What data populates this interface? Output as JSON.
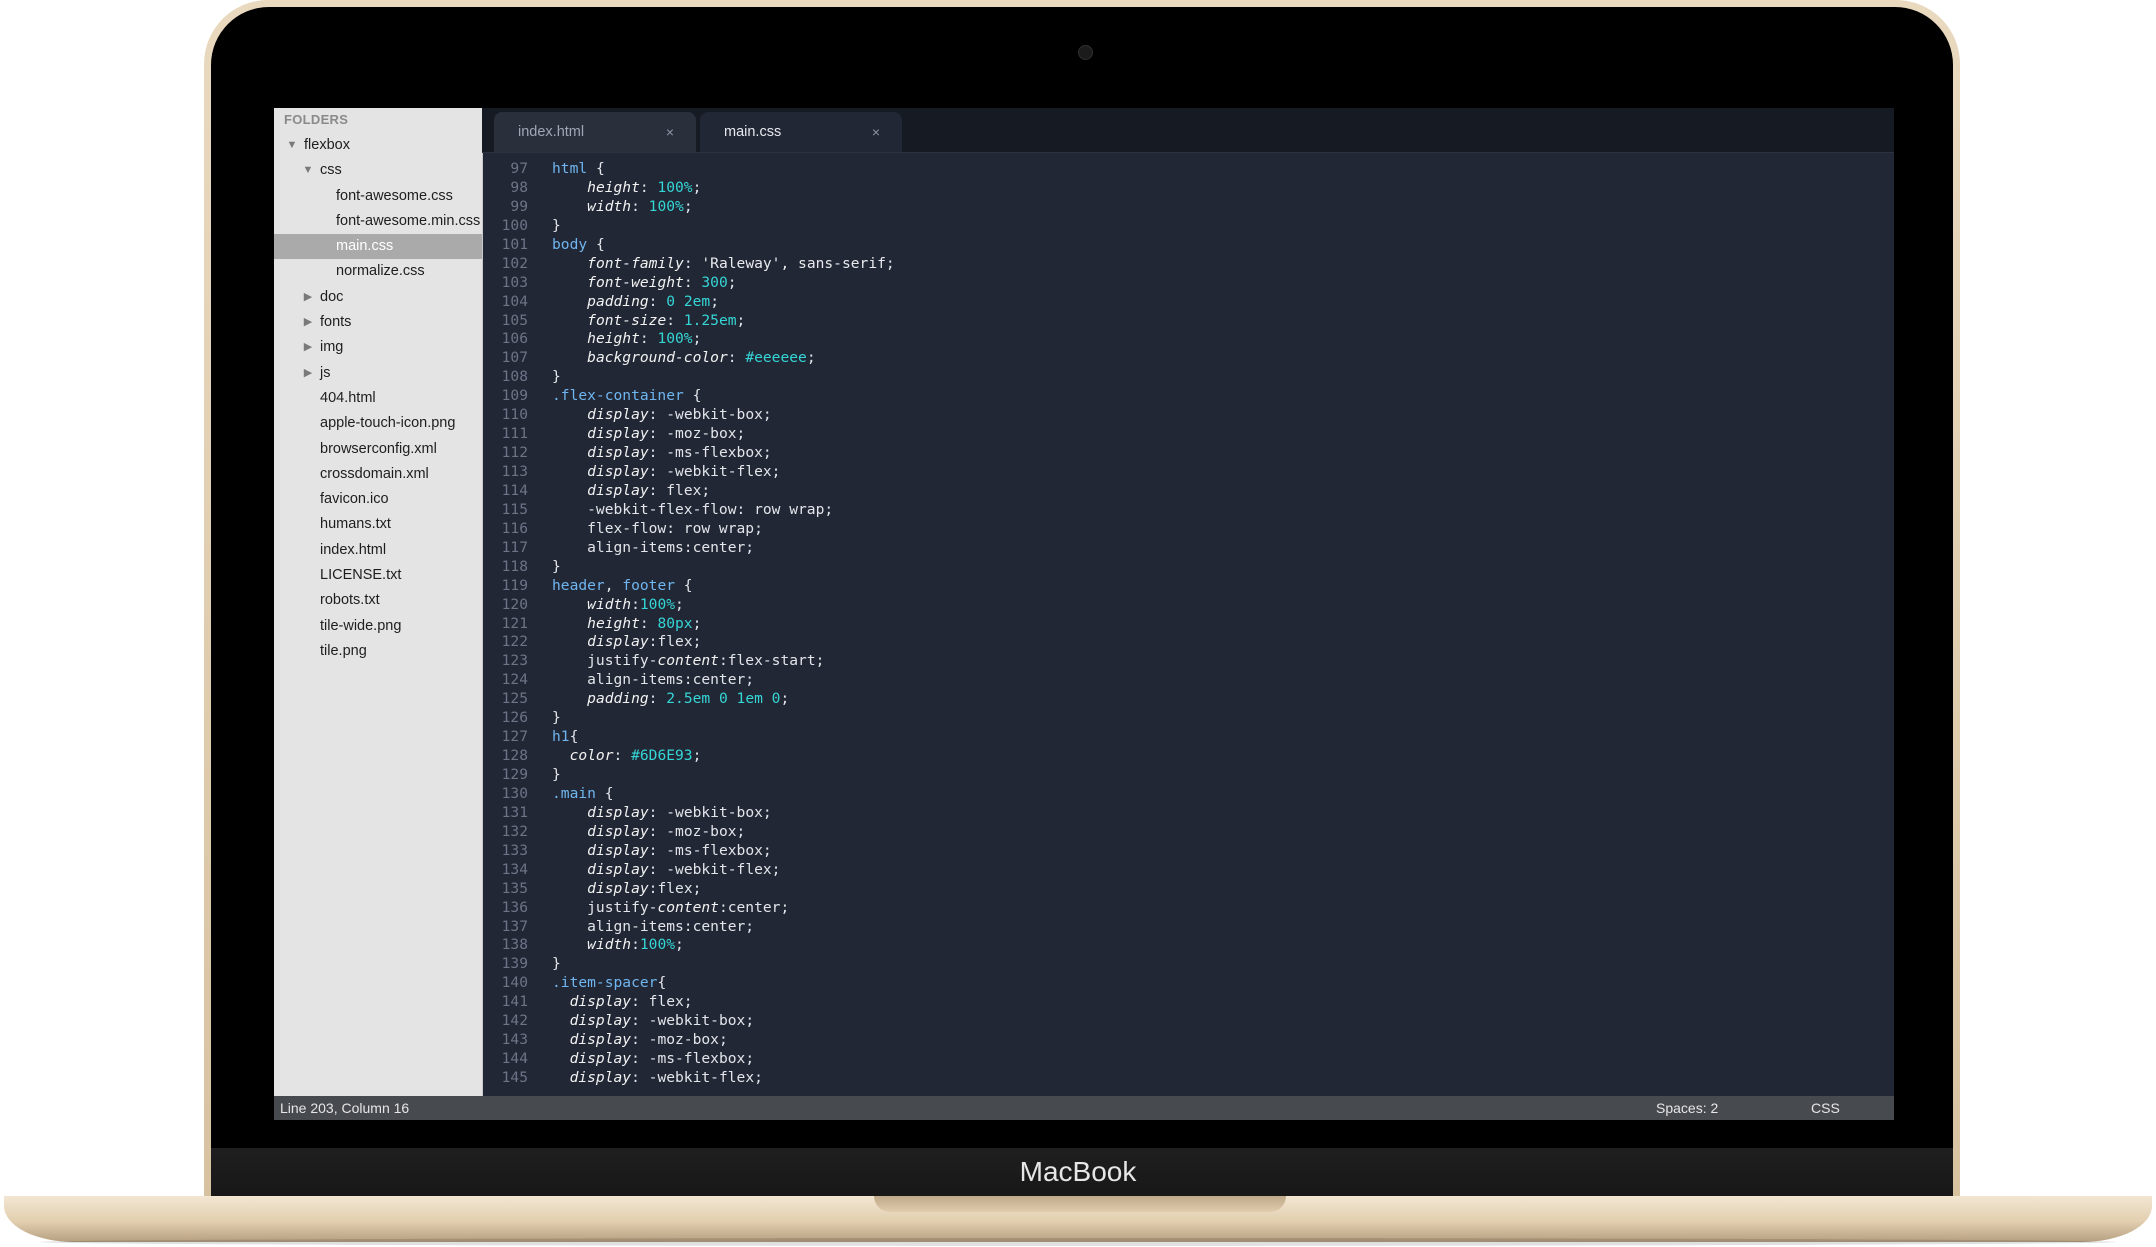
{
  "device": {
    "brand": "MacBook"
  },
  "sidebar": {
    "header": "FOLDERS",
    "tree": [
      {
        "label": "flexbox",
        "depth": 0,
        "arrow": "open"
      },
      {
        "label": "css",
        "depth": 1,
        "arrow": "open"
      },
      {
        "label": "font-awesome.css",
        "depth": 2,
        "arrow": "none"
      },
      {
        "label": "font-awesome.min.css",
        "depth": 2,
        "arrow": "none"
      },
      {
        "label": "main.css",
        "depth": 2,
        "arrow": "none",
        "selected": true
      },
      {
        "label": "normalize.css",
        "depth": 2,
        "arrow": "none"
      },
      {
        "label": "doc",
        "depth": 1,
        "arrow": "closed"
      },
      {
        "label": "fonts",
        "depth": 1,
        "arrow": "closed"
      },
      {
        "label": "img",
        "depth": 1,
        "arrow": "closed"
      },
      {
        "label": "js",
        "depth": 1,
        "arrow": "closed"
      },
      {
        "label": "404.html",
        "depth": 1,
        "arrow": "none"
      },
      {
        "label": "apple-touch-icon.png",
        "depth": 1,
        "arrow": "none"
      },
      {
        "label": "browserconfig.xml",
        "depth": 1,
        "arrow": "none"
      },
      {
        "label": "crossdomain.xml",
        "depth": 1,
        "arrow": "none"
      },
      {
        "label": "favicon.ico",
        "depth": 1,
        "arrow": "none"
      },
      {
        "label": "humans.txt",
        "depth": 1,
        "arrow": "none"
      },
      {
        "label": "index.html",
        "depth": 1,
        "arrow": "none"
      },
      {
        "label": "LICENSE.txt",
        "depth": 1,
        "arrow": "none"
      },
      {
        "label": "robots.txt",
        "depth": 1,
        "arrow": "none"
      },
      {
        "label": "tile-wide.png",
        "depth": 1,
        "arrow": "none"
      },
      {
        "label": "tile.png",
        "depth": 1,
        "arrow": "none"
      }
    ]
  },
  "tabs": [
    {
      "label": "index.html",
      "close": "×",
      "active": false
    },
    {
      "label": "main.css",
      "close": "×",
      "active": true
    }
  ],
  "editor": {
    "lines": [
      {
        "n": "97",
        "t": [
          [
            "html",
            "sel"
          ],
          [
            " {",
            "punc"
          ]
        ]
      },
      {
        "n": "98",
        "t": [
          [
            "    ",
            "punc"
          ],
          [
            "height",
            "prop"
          ],
          [
            ": ",
            "punc"
          ],
          [
            "100%",
            "num"
          ],
          [
            ";",
            "punc"
          ]
        ]
      },
      {
        "n": "99",
        "t": [
          [
            "    ",
            "punc"
          ],
          [
            "width",
            "prop"
          ],
          [
            ": ",
            "punc"
          ],
          [
            "100%",
            "num"
          ],
          [
            ";",
            "punc"
          ]
        ]
      },
      {
        "n": "100",
        "t": [
          [
            "}",
            "punc"
          ]
        ]
      },
      {
        "n": "101",
        "t": [
          [
            "body",
            "sel"
          ],
          [
            " {",
            "punc"
          ]
        ]
      },
      {
        "n": "102",
        "t": [
          [
            "    ",
            "punc"
          ],
          [
            "font-family",
            "prop"
          ],
          [
            ": ",
            "punc"
          ],
          [
            "'Raleway', sans-serif",
            "str"
          ],
          [
            ";",
            "punc"
          ]
        ]
      },
      {
        "n": "103",
        "t": [
          [
            "    ",
            "punc"
          ],
          [
            "font-weight",
            "prop"
          ],
          [
            ": ",
            "punc"
          ],
          [
            "300",
            "num"
          ],
          [
            ";",
            "punc"
          ]
        ]
      },
      {
        "n": "104",
        "t": [
          [
            "    ",
            "punc"
          ],
          [
            "padding",
            "prop"
          ],
          [
            ": ",
            "punc"
          ],
          [
            "0 2em",
            "num"
          ],
          [
            ";",
            "punc"
          ]
        ]
      },
      {
        "n": "105",
        "t": [
          [
            "    ",
            "punc"
          ],
          [
            "font-size",
            "prop"
          ],
          [
            ": ",
            "punc"
          ],
          [
            "1.25em",
            "num"
          ],
          [
            ";",
            "punc"
          ]
        ]
      },
      {
        "n": "106",
        "t": [
          [
            "    ",
            "punc"
          ],
          [
            "height",
            "prop"
          ],
          [
            ": ",
            "punc"
          ],
          [
            "100%",
            "num"
          ],
          [
            ";",
            "punc"
          ]
        ]
      },
      {
        "n": "107",
        "t": [
          [
            "    ",
            "punc"
          ],
          [
            "background-color",
            "prop"
          ],
          [
            ": ",
            "punc"
          ],
          [
            "#eeeeee",
            "num"
          ],
          [
            ";",
            "punc"
          ]
        ]
      },
      {
        "n": "108",
        "t": [
          [
            "}",
            "punc"
          ]
        ]
      },
      {
        "n": "109",
        "t": [
          [
            ".flex-container",
            "sel"
          ],
          [
            " {",
            "punc"
          ]
        ]
      },
      {
        "n": "110",
        "t": [
          [
            "    ",
            "punc"
          ],
          [
            "display",
            "prop"
          ],
          [
            ": -webkit-box;",
            "punc"
          ]
        ]
      },
      {
        "n": "111",
        "t": [
          [
            "    ",
            "punc"
          ],
          [
            "display",
            "prop"
          ],
          [
            ": -moz-box;",
            "punc"
          ]
        ]
      },
      {
        "n": "112",
        "t": [
          [
            "    ",
            "punc"
          ],
          [
            "display",
            "prop"
          ],
          [
            ": -ms-flexbox;",
            "punc"
          ]
        ]
      },
      {
        "n": "113",
        "t": [
          [
            "    ",
            "punc"
          ],
          [
            "display",
            "prop"
          ],
          [
            ": -webkit-flex;",
            "punc"
          ]
        ]
      },
      {
        "n": "114",
        "t": [
          [
            "    ",
            "punc"
          ],
          [
            "display",
            "prop"
          ],
          [
            ": flex;",
            "punc"
          ]
        ]
      },
      {
        "n": "115",
        "t": [
          [
            "    -webkit-flex-flow: row wrap;",
            "punc"
          ]
        ]
      },
      {
        "n": "116",
        "t": [
          [
            "    flex-flow: row wrap;",
            "punc"
          ]
        ]
      },
      {
        "n": "117",
        "t": [
          [
            "    align-items:center;",
            "punc"
          ]
        ]
      },
      {
        "n": "118",
        "t": [
          [
            "}",
            "punc"
          ]
        ]
      },
      {
        "n": "119",
        "t": [
          [
            "header",
            "sel"
          ],
          [
            ", ",
            "punc"
          ],
          [
            "footer",
            "sel"
          ],
          [
            " {",
            "punc"
          ]
        ]
      },
      {
        "n": "120",
        "t": [
          [
            "    ",
            "punc"
          ],
          [
            "width",
            "prop"
          ],
          [
            ":",
            "punc"
          ],
          [
            "100%",
            "num"
          ],
          [
            ";",
            "punc"
          ]
        ]
      },
      {
        "n": "121",
        "t": [
          [
            "    ",
            "punc"
          ],
          [
            "height",
            "prop"
          ],
          [
            ": ",
            "punc"
          ],
          [
            "80px",
            "num"
          ],
          [
            ";",
            "punc"
          ]
        ]
      },
      {
        "n": "122",
        "t": [
          [
            "    ",
            "punc"
          ],
          [
            "display",
            "prop"
          ],
          [
            ":flex;",
            "punc"
          ]
        ]
      },
      {
        "n": "123",
        "t": [
          [
            "    justify-",
            "punc"
          ],
          [
            "content",
            "prop"
          ],
          [
            ":flex-start;",
            "punc"
          ]
        ]
      },
      {
        "n": "124",
        "t": [
          [
            "    align-items:center;",
            "punc"
          ]
        ]
      },
      {
        "n": "125",
        "t": [
          [
            "    ",
            "punc"
          ],
          [
            "padding",
            "prop"
          ],
          [
            ": ",
            "punc"
          ],
          [
            "2.5em 0 1em 0",
            "num"
          ],
          [
            ";",
            "punc"
          ]
        ]
      },
      {
        "n": "126",
        "t": [
          [
            "}",
            "punc"
          ]
        ]
      },
      {
        "n": "127",
        "t": [
          [
            "h1",
            "sel"
          ],
          [
            "{",
            "punc"
          ]
        ]
      },
      {
        "n": "128",
        "t": [
          [
            "  ",
            "punc"
          ],
          [
            "color",
            "prop"
          ],
          [
            ": ",
            "punc"
          ],
          [
            "#6D6E93",
            "num"
          ],
          [
            ";",
            "punc"
          ]
        ]
      },
      {
        "n": "129",
        "t": [
          [
            "}",
            "punc"
          ]
        ]
      },
      {
        "n": "130",
        "t": [
          [
            ".main",
            "sel"
          ],
          [
            " {",
            "punc"
          ]
        ]
      },
      {
        "n": "131",
        "t": [
          [
            "    ",
            "punc"
          ],
          [
            "display",
            "prop"
          ],
          [
            ": -webkit-box;",
            "punc"
          ]
        ]
      },
      {
        "n": "132",
        "t": [
          [
            "    ",
            "punc"
          ],
          [
            "display",
            "prop"
          ],
          [
            ": -moz-box;",
            "punc"
          ]
        ]
      },
      {
        "n": "133",
        "t": [
          [
            "    ",
            "punc"
          ],
          [
            "display",
            "prop"
          ],
          [
            ": -ms-flexbox;",
            "punc"
          ]
        ]
      },
      {
        "n": "134",
        "t": [
          [
            "    ",
            "punc"
          ],
          [
            "display",
            "prop"
          ],
          [
            ": -webkit-flex;",
            "punc"
          ]
        ]
      },
      {
        "n": "135",
        "t": [
          [
            "    ",
            "punc"
          ],
          [
            "display",
            "prop"
          ],
          [
            ":flex;",
            "punc"
          ]
        ]
      },
      {
        "n": "136",
        "t": [
          [
            "    justify-",
            "punc"
          ],
          [
            "content",
            "prop"
          ],
          [
            ":center;",
            "punc"
          ]
        ]
      },
      {
        "n": "137",
        "t": [
          [
            "    align-items:center;",
            "punc"
          ]
        ]
      },
      {
        "n": "138",
        "t": [
          [
            "    ",
            "punc"
          ],
          [
            "width",
            "prop"
          ],
          [
            ":",
            "punc"
          ],
          [
            "100%",
            "num"
          ],
          [
            ";",
            "punc"
          ]
        ]
      },
      {
        "n": "139",
        "t": [
          [
            "}",
            "punc"
          ]
        ]
      },
      {
        "n": "140",
        "t": [
          [
            ".item-spacer",
            "sel"
          ],
          [
            "{",
            "punc"
          ]
        ]
      },
      {
        "n": "141",
        "t": [
          [
            "  ",
            "punc"
          ],
          [
            "display",
            "prop"
          ],
          [
            ": flex;",
            "punc"
          ]
        ]
      },
      {
        "n": "142",
        "t": [
          [
            "  ",
            "punc"
          ],
          [
            "display",
            "prop"
          ],
          [
            ": -webkit-box;",
            "punc"
          ]
        ]
      },
      {
        "n": "143",
        "t": [
          [
            "  ",
            "punc"
          ],
          [
            "display",
            "prop"
          ],
          [
            ": -moz-box;",
            "punc"
          ]
        ]
      },
      {
        "n": "144",
        "t": [
          [
            "  ",
            "punc"
          ],
          [
            "display",
            "prop"
          ],
          [
            ": -ms-flexbox;",
            "punc"
          ]
        ]
      },
      {
        "n": "145",
        "t": [
          [
            "  ",
            "punc"
          ],
          [
            "display",
            "prop"
          ],
          [
            ": -webkit-flex;",
            "punc"
          ]
        ]
      }
    ]
  },
  "status": {
    "position": "Line 203, Column 16",
    "spaces": "Spaces: 2",
    "syntax": "CSS"
  },
  "colors": {
    "editor_bg": "#222735",
    "selector": "#6fb6f0",
    "number": "#35d6d6",
    "sidebar_bg": "#e4e4e4",
    "laptop_gold": "#e0cdae"
  }
}
